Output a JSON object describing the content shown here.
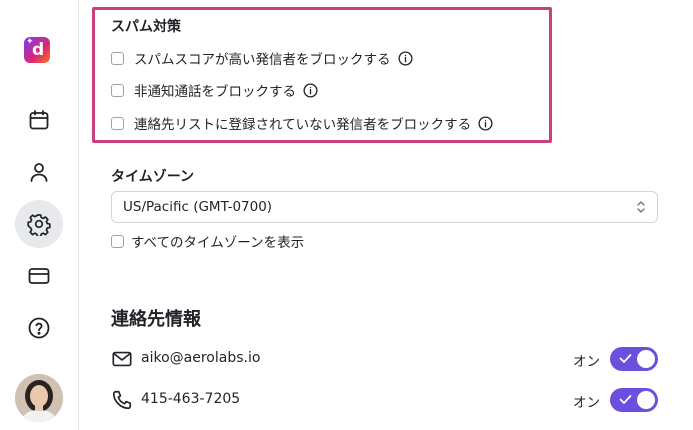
{
  "spam": {
    "title": "スパム対策",
    "options": [
      {
        "label": "スパムスコアが高い発信者をブロックする",
        "checked": false
      },
      {
        "label": "非通知通話をブロックする",
        "checked": false
      },
      {
        "label": "連絡先リストに登録されていない発信者をブロックする",
        "checked": false
      }
    ]
  },
  "timezone": {
    "title": "タイムゾーン",
    "selected": "US/Pacific (GMT-0700)",
    "show_all_label": "すべてのタイムゾーンを表示",
    "show_all_checked": false
  },
  "contact": {
    "title": "連絡先情報",
    "email": "aiko@aerolabs.io",
    "email_toggle_label": "オン",
    "email_enabled": true,
    "phone": "415-463-7205",
    "phone_toggle_label": "オン",
    "phone_enabled": true
  },
  "sidebar": {
    "items": [
      {
        "icon": "calendar-icon",
        "active": false
      },
      {
        "icon": "user-icon",
        "active": false
      },
      {
        "icon": "gear-icon",
        "active": true
      },
      {
        "icon": "credit-card-icon",
        "active": false
      },
      {
        "icon": "help-icon",
        "active": false
      }
    ]
  },
  "colors": {
    "accent": "#6d4fe0",
    "highlight_border": "#cc3f7e"
  }
}
